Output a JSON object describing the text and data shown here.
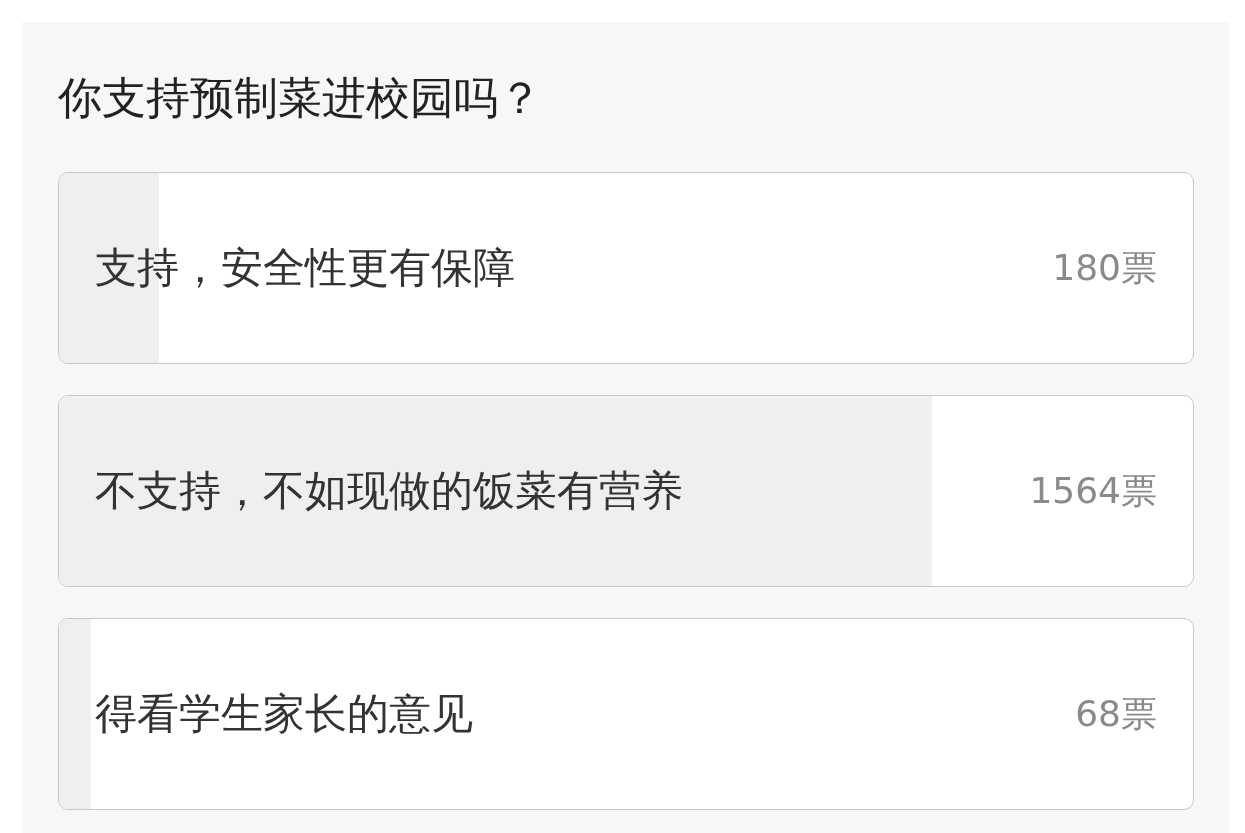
{
  "poll": {
    "question": "你支持预制菜进校园吗？",
    "options": [
      {
        "label": "支持，安全性更有保障",
        "votes": "180票",
        "level": 0.088
      },
      {
        "label": "不支持，不如现做的饭菜有营养",
        "votes": "1564票",
        "level": 0.77
      },
      {
        "label": "得看学生家长的意见",
        "votes": "68票",
        "level": 0.028
      }
    ]
  }
}
